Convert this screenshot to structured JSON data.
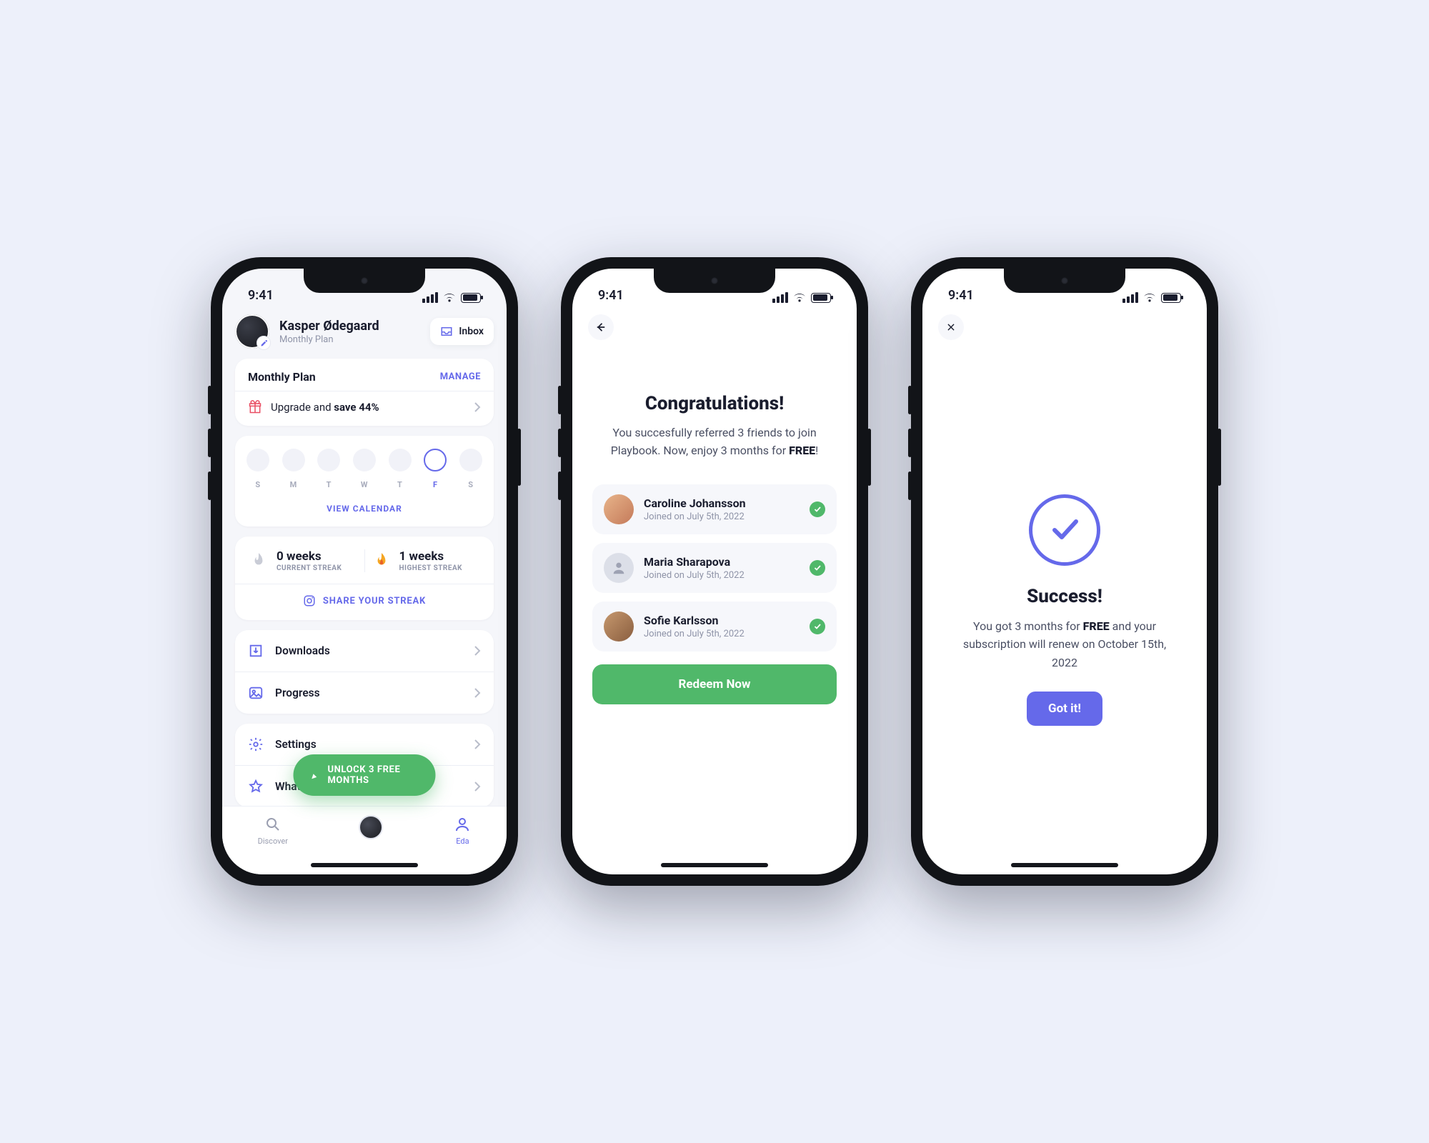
{
  "status": {
    "time": "9:41"
  },
  "screen1": {
    "profile": {
      "name": "Kasper Ødegaard",
      "plan": "Monthly Plan"
    },
    "inbox_label": "Inbox",
    "plan_card": {
      "title": "Monthly Plan",
      "manage": "MANAGE",
      "upgrade_prefix": "Upgrade and ",
      "upgrade_bold": "save 44%"
    },
    "week": {
      "days": [
        {
          "lbl": "S"
        },
        {
          "lbl": "M"
        },
        {
          "lbl": "T"
        },
        {
          "lbl": "W"
        },
        {
          "lbl": "T"
        },
        {
          "lbl": "F",
          "active": true
        },
        {
          "lbl": "S"
        }
      ],
      "view_calendar": "VIEW CALENDAR"
    },
    "streak": {
      "current_value": "0 weeks",
      "current_label": "CURRENT STREAK",
      "highest_value": "1 weeks",
      "highest_label": "HIGHEST STREAK",
      "share": "SHARE YOUR STREAK"
    },
    "menu": {
      "downloads": "Downloads",
      "progress": "Progress",
      "settings": "Settings",
      "whats_new": "What's New"
    },
    "unlock_label": "UNLOCK 3 FREE MONTHS",
    "tabs": {
      "discover": "Discover",
      "eda": "Eda"
    }
  },
  "screen2": {
    "title": "Congratulations!",
    "body_1": "You succesfully referred 3 friends to join Playbook. Now, enjoy 3 months for ",
    "body_bold": "FREE",
    "body_2": "!",
    "friends": [
      {
        "name": "Caroline Johansson",
        "joined": "Joined on July 5th, 2022"
      },
      {
        "name": "Maria Sharapova",
        "joined": "Joined on July 5th, 2022"
      },
      {
        "name": "Sofie Karlsson",
        "joined": "Joined on July 5th, 2022"
      }
    ],
    "redeem": "Redeem Now"
  },
  "screen3": {
    "title": "Success!",
    "body_1": "You got 3 months for ",
    "body_bold": "FREE",
    "body_2": " and your subscription will renew on October 15th, 2022",
    "gotit": "Got it!"
  }
}
